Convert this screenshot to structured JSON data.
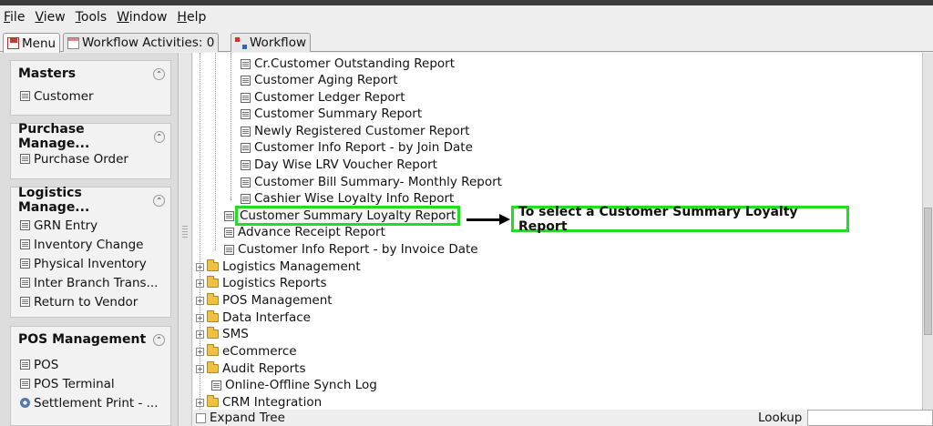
{
  "menubar": [
    "File",
    "View",
    "Tools",
    "Window",
    "Help"
  ],
  "tabs": {
    "menu": "Menu",
    "workflow_activities": "Workflow Activities: 0",
    "workflow": "Workflow"
  },
  "left_panel": {
    "groups": [
      {
        "title": "Masters",
        "items": [
          "Customer"
        ]
      },
      {
        "title": "Purchase Manage...",
        "items": [
          "Purchase Order"
        ]
      },
      {
        "title": "Logistics Manage...",
        "items": [
          "GRN Entry",
          "Inventory Change",
          "Physical Inventory",
          "Inter Branch Trans...",
          "Return to Vendor"
        ]
      },
      {
        "title": "POS Management",
        "items": [
          "POS",
          "POS Terminal",
          "Settlement Print - ..."
        ]
      }
    ]
  },
  "tree": {
    "reports": [
      "Cr.Customer Outstanding Report",
      "Customer Aging Report",
      "Customer Ledger Report",
      "Customer Summary Report",
      "Newly Registered Customer Report",
      "Customer Info Report - by Join Date",
      "Day Wise LRV Voucher Report",
      "Customer Bill Summary- Monthly Report",
      "Cashier Wise Loyalty Info Report"
    ],
    "mid_reports": [
      "Customer Summary Loyalty Report",
      "Advance Receipt Report",
      "Customer Info Report - by Invoice Date"
    ],
    "folders": [
      "Logistics Management",
      "Logistics Reports",
      "POS Management",
      "Data Interface",
      "SMS",
      "eCommerce",
      "Audit Reports"
    ],
    "leaf_bottom": "Online-Offline Synch Log",
    "last_folder": "CRM Integration"
  },
  "annotation": {
    "text": "To select a Customer Summary Loyalty Report",
    "color": "#22dd22"
  },
  "bottom": {
    "expand_tree": "Expand Tree",
    "lookup": "Lookup"
  }
}
